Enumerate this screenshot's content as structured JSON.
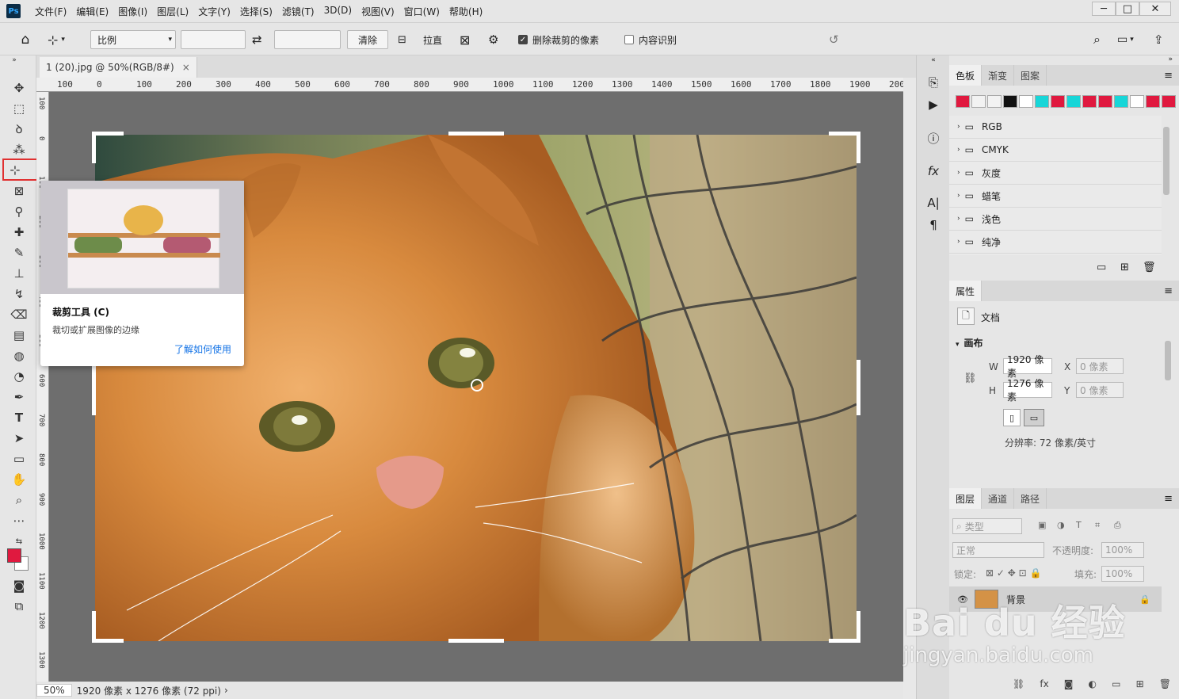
{
  "menubar": {
    "logo": "Ps",
    "items": [
      "文件(F)",
      "编辑(E)",
      "图像(I)",
      "图层(L)",
      "文字(Y)",
      "选择(S)",
      "滤镜(T)",
      "3D(D)",
      "视图(V)",
      "窗口(W)",
      "帮助(H)"
    ],
    "window_controls": [
      "─",
      "□",
      "✕"
    ]
  },
  "options": {
    "ratio_select": "比例",
    "ratio_w": "",
    "ratio_h": "",
    "clear_label": "清除",
    "straighten_label": "拉直",
    "delete_cropped_label": "删除裁剪的像素",
    "delete_cropped_checked": true,
    "content_aware_label": "内容识别",
    "content_aware_checked": false
  },
  "document": {
    "tab_title": "1 (20).jpg @ 50%(RGB/8#)",
    "tab_close": "×",
    "ruler_h_labels": [
      "100",
      "0",
      "100",
      "200",
      "300",
      "400",
      "500",
      "600",
      "700",
      "800",
      "900",
      "1000",
      "1100",
      "1200",
      "1300",
      "1400",
      "1500",
      "1600",
      "1700",
      "1800",
      "1900",
      "200"
    ],
    "ruler_v_labels": [
      "100",
      "0",
      "100",
      "200",
      "300",
      "400",
      "500",
      "600",
      "700",
      "800",
      "900",
      "1000",
      "1100",
      "1200",
      "1300",
      "1400",
      "1500"
    ]
  },
  "tooltip": {
    "title": "裁剪工具 (C)",
    "description": "裁切或扩展图像的边缘",
    "link": "了解如何使用"
  },
  "statusbar": {
    "zoom": "50%",
    "info": "1920 像素 x 1276 像素 (72 ppi)",
    "arrow": "›"
  },
  "swatches_panel": {
    "tabs": [
      "色板",
      "渐变",
      "图案"
    ],
    "active_tab": "色板",
    "colors": [
      "#e0193f",
      "#f2f2f2",
      "#f2f2f2",
      "#111111",
      "#ffffff",
      "#17d6d8",
      "#e0193f",
      "#17d6d8",
      "#e0193f",
      "#e0193f",
      "#17d6d8",
      "#ffffff",
      "#e0193f",
      "#e0193f",
      "#111111"
    ],
    "folders": [
      "RGB",
      "CMYK",
      "灰度",
      "蜡笔",
      "浅色",
      "纯净"
    ]
  },
  "properties_panel": {
    "tab": "属性",
    "doc_label": "文档",
    "section": "画布",
    "w_label": "W",
    "w_value": "1920 像素",
    "h_label": "H",
    "h_value": "1276 像素",
    "x_label": "X",
    "x_value": "0 像素",
    "y_label": "Y",
    "y_value": "0 像素",
    "resolution": "分辨率: 72 像素/英寸"
  },
  "layers_panel": {
    "tabs": [
      "图层",
      "通道",
      "路径"
    ],
    "active_tab": "图层",
    "filter_label": "类型",
    "blend_mode": "正常",
    "opacity_label": "不透明度:",
    "opacity_value": "100%",
    "lock_label": "锁定:",
    "fill_label": "填充:",
    "fill_value": "100%",
    "layer_name": "背景"
  },
  "watermark": {
    "brand": "Bai du 经验",
    "url": "jingyan.baidu.com"
  },
  "colors": {
    "foreground": "#e0193f",
    "background": "#ffffff",
    "link": "#1473e6",
    "crop_highlight": "#e03030"
  }
}
